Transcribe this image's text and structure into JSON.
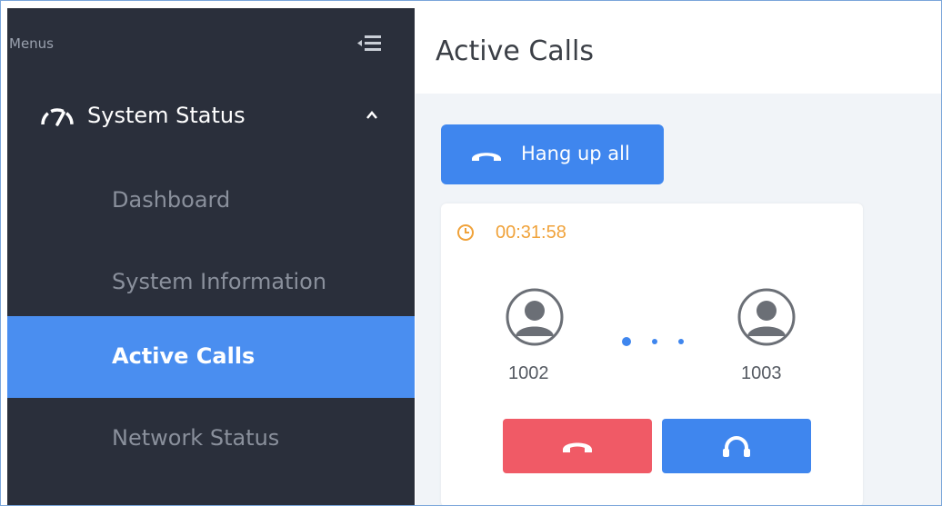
{
  "sidebar": {
    "menus_label": "Menus",
    "section": {
      "title": "System Status",
      "icon": "gauge-icon",
      "expanded": true
    },
    "items": [
      {
        "label": "Dashboard",
        "active": false
      },
      {
        "label": "System Information",
        "active": false
      },
      {
        "label": "Active Calls",
        "active": true
      },
      {
        "label": "Network Status",
        "active": false
      }
    ]
  },
  "main": {
    "page_title": "Active Calls",
    "hangup_all_label": "Hang up all",
    "call": {
      "duration": "00:31:58",
      "caller": "1002",
      "callee": "1003"
    }
  },
  "colors": {
    "sidebar_bg": "#2a2f3b",
    "accent_blue": "#3f86ee",
    "active_item": "#4a8ef0",
    "hangup_red": "#f05a66",
    "timer_orange": "#f0a23a"
  }
}
